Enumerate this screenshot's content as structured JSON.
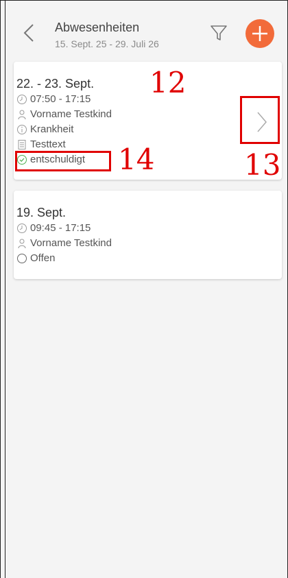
{
  "header": {
    "title": "Abwesenheiten",
    "subtitle": "15. Sept. 25 - 29. Juli 26",
    "back_icon": "chevron-left-icon",
    "filter_icon": "filter-icon",
    "add_icon": "plus-icon",
    "accent": "#f26b3a"
  },
  "cards": [
    {
      "date": "22. - 23. Sept.",
      "time": "07:50 - 17:15",
      "child": "Vorname Testkind",
      "reason": "Krankheit",
      "note": "Testtext",
      "status": "entschuldigt",
      "status_color": "#4caf50"
    },
    {
      "date": "19. Sept.",
      "time": "09:45 - 17:15",
      "child": "Vorname Testkind",
      "status": "Offen"
    }
  ],
  "annotations": {
    "label_12": "12",
    "label_13": "13",
    "label_14": "14",
    "color": "#e00000"
  }
}
